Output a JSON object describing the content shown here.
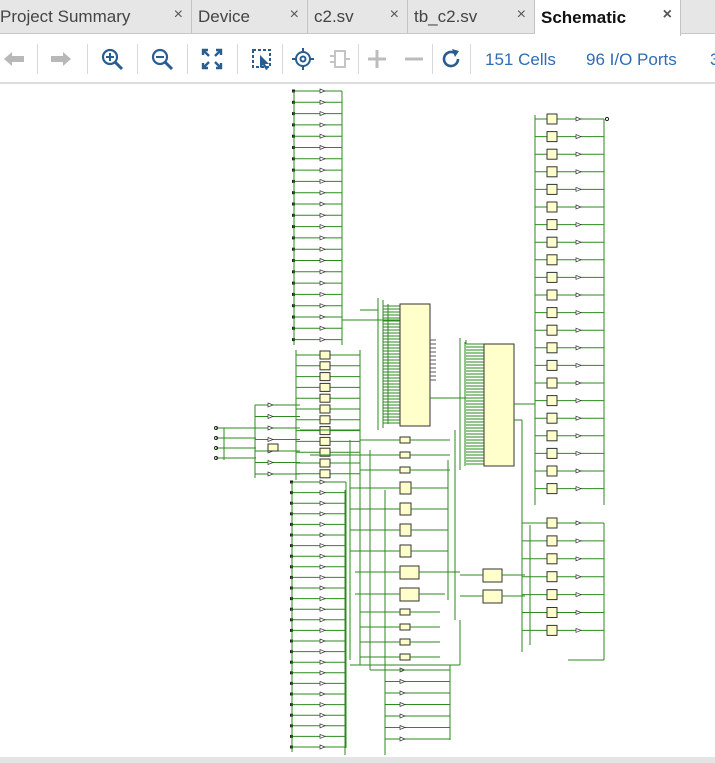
{
  "tabs": [
    {
      "label": "Project Summary",
      "close": "×",
      "active": false
    },
    {
      "label": "Device",
      "close": "×",
      "active": false
    },
    {
      "label": "c2.sv",
      "close": "×",
      "active": false
    },
    {
      "label": "tb_c2.sv",
      "close": "×",
      "active": false
    },
    {
      "label": "Schematic",
      "close": "×",
      "active": true
    }
  ],
  "toolbar": {
    "buttons": [
      "back-icon",
      "forward-icon",
      "zoom-in-icon",
      "zoom-out-icon",
      "zoom-fit-icon",
      "select-area-icon",
      "crosshair-icon",
      "cell-icon",
      "add-icon",
      "remove-icon",
      "refresh-icon"
    ],
    "cells": "151 Cells",
    "ports": "96 I/O Ports",
    "overflow": "3"
  },
  "schematic": {
    "wire_color": "#2d8a1f",
    "cell_fill": "#ffffcc",
    "cell_border": "#333333"
  }
}
